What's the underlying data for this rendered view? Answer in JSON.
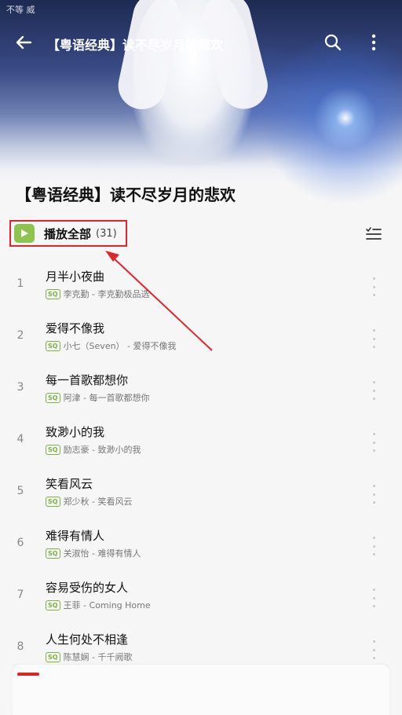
{
  "status_bar": {
    "text": "不等 威"
  },
  "header": {
    "title": "【粤语经典】读不尽岁月的悲欢",
    "back_icon": "arrow-left-icon",
    "search_icon": "search-icon",
    "more_icon": "more-vertical-icon"
  },
  "playlist": {
    "title": "【粤语经典】读不尽岁月的悲欢",
    "play_all_label": "播放全部",
    "count": "(31)",
    "accent_color": "#8cc44f",
    "highlight_color": "#e0252b"
  },
  "songs": [
    {
      "index": "1",
      "title": "月半小夜曲",
      "quality": "SQ",
      "artist": "李克勤 - 李克勤极品选"
    },
    {
      "index": "2",
      "title": "爱得不像我",
      "quality": "SQ",
      "artist": "小七（Seven） - 爱得不像我"
    },
    {
      "index": "3",
      "title": "每一首歌都想你",
      "quality": "SQ",
      "artist": "阿津 - 每一首歌都想你"
    },
    {
      "index": "4",
      "title": "致渺小的我",
      "quality": "SQ",
      "artist": "励志豪 - 致渺小的我"
    },
    {
      "index": "5",
      "title": "笑看风云",
      "quality": "SQ",
      "artist": "郑少秋 - 笑看风云"
    },
    {
      "index": "6",
      "title": "难得有情人",
      "quality": "SQ",
      "artist": "关淑怡 - 难得有情人"
    },
    {
      "index": "7",
      "title": "容易受伤的女人",
      "quality": "SQ",
      "artist": "王菲 - Coming Home"
    },
    {
      "index": "8",
      "title": "人生何处不相逢",
      "quality": "SQ",
      "artist": "陈慧娴 - 千千阙歌"
    }
  ]
}
